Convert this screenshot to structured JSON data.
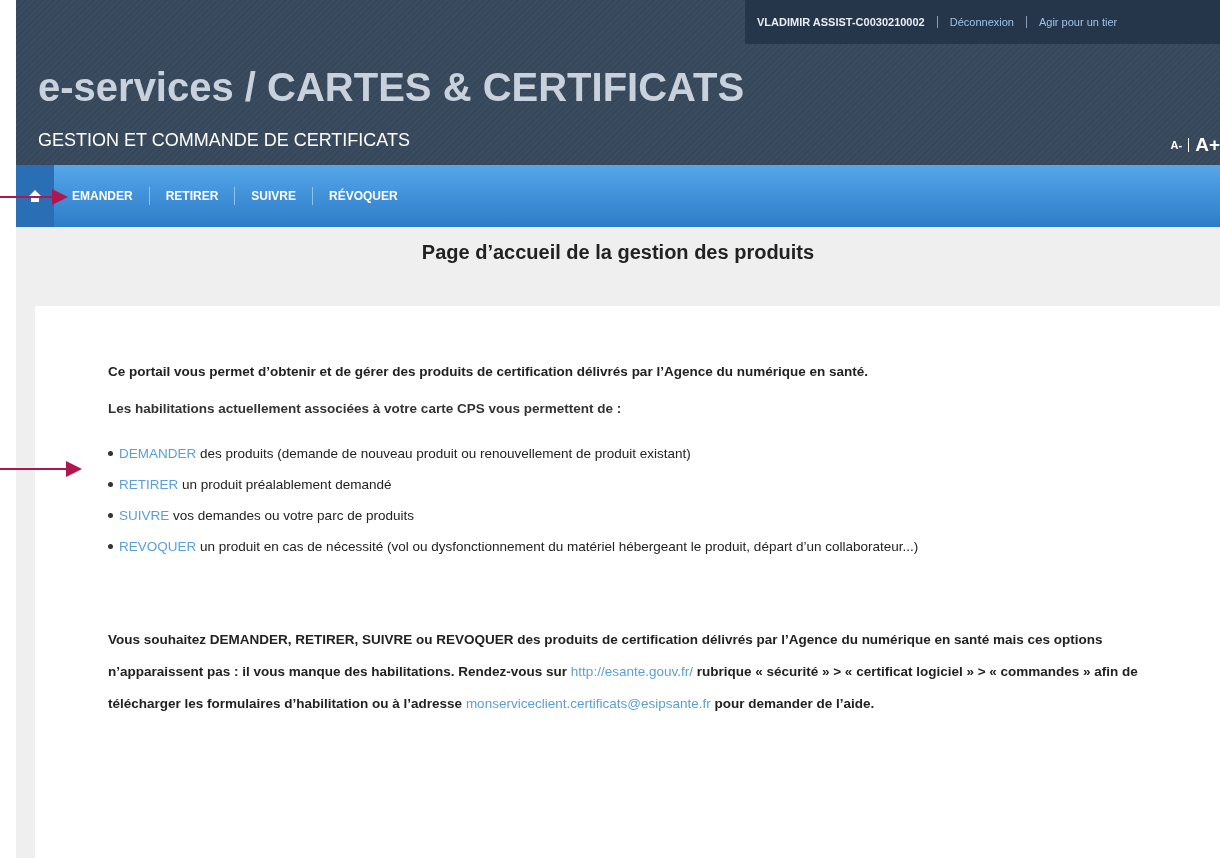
{
  "top_bar": {
    "user": "VLADIMIR ASSIST-C0030210002",
    "links": [
      "Déconnexion",
      "Agir pour un tier"
    ]
  },
  "header": {
    "title": "e-services / CARTES & CERTIFICATS",
    "subtitle": "GESTION ET COMMANDE DE CERTIFICATS",
    "font_controls": [
      "A-",
      "A+"
    ]
  },
  "nav": {
    "items": [
      "EMANDER",
      "RETIRER",
      "SUIVRE",
      "RÉVOQUER"
    ]
  },
  "page_title": "Page d’accueil de la gestion des produits",
  "intro": [
    "Ce portail vous permet d’obtenir et de gérer des produits de certification délivrés par l’Agence du numérique en santé.",
    "Les habilitations actuellement associées à votre carte **CPS** vous permettent de :"
  ],
  "actions": [
    {
      "link": "DEMANDER",
      "text": "des produits (demande de nouveau produit ou renouvellement de produit existant)"
    },
    {
      "link": "RETIRER",
      "text": "un produit préalablement demandé"
    },
    {
      "link": "SUIVRE",
      "text": "vos demandes ou votre parc de produits"
    },
    {
      "link": "REVOQUER",
      "text": "un produit en cas de nécessité (vol ou dysfonctionnement du matériel hébergeant le produit, départ d’un collaborateur...)"
    }
  ],
  "help": [
    {
      "kind": "text",
      "text": "Vous souhaitez DEMANDER, RETIRER, SUIVRE ou REVOQUER des produits de certification délivrés par l’Agence du numérique en santé mais ces options n’apparaissent pas : il vous manque des habilitations. Rendez-vous sur "
    },
    {
      "kind": "link",
      "text": "http://esante.gouv.fr/"
    },
    {
      "kind": "text",
      "text": " rubrique « sécurité » > « certificat logiciel » > « commandes » afin de télécharger les formulaires d’habilitation ou à l’adresse "
    },
    {
      "kind": "link",
      "text": "monserviceclient.certificats@esipsante.fr"
    },
    {
      "kind": "text",
      "text": " pour demander de l’aide."
    }
  ],
  "annotations": [
    {
      "kind": "arrow"
    },
    {
      "kind": "arrow"
    }
  ]
}
